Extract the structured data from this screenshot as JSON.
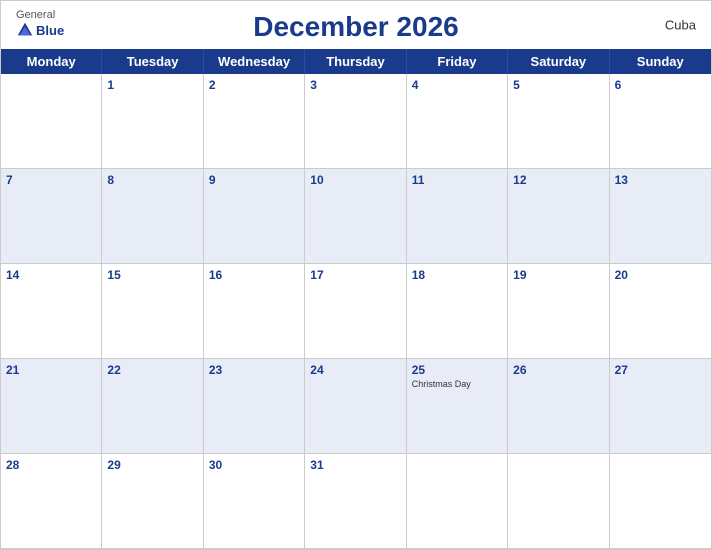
{
  "header": {
    "logo_general": "General",
    "logo_blue": "Blue",
    "title": "December 2026",
    "country": "Cuba"
  },
  "day_headers": [
    "Monday",
    "Tuesday",
    "Wednesday",
    "Thursday",
    "Friday",
    "Saturday",
    "Sunday"
  ],
  "weeks": [
    [
      {
        "date": "",
        "event": ""
      },
      {
        "date": "1",
        "event": ""
      },
      {
        "date": "2",
        "event": ""
      },
      {
        "date": "3",
        "event": ""
      },
      {
        "date": "4",
        "event": ""
      },
      {
        "date": "5",
        "event": ""
      },
      {
        "date": "6",
        "event": ""
      }
    ],
    [
      {
        "date": "7",
        "event": ""
      },
      {
        "date": "8",
        "event": ""
      },
      {
        "date": "9",
        "event": ""
      },
      {
        "date": "10",
        "event": ""
      },
      {
        "date": "11",
        "event": ""
      },
      {
        "date": "12",
        "event": ""
      },
      {
        "date": "13",
        "event": ""
      }
    ],
    [
      {
        "date": "14",
        "event": ""
      },
      {
        "date": "15",
        "event": ""
      },
      {
        "date": "16",
        "event": ""
      },
      {
        "date": "17",
        "event": ""
      },
      {
        "date": "18",
        "event": ""
      },
      {
        "date": "19",
        "event": ""
      },
      {
        "date": "20",
        "event": ""
      }
    ],
    [
      {
        "date": "21",
        "event": ""
      },
      {
        "date": "22",
        "event": ""
      },
      {
        "date": "23",
        "event": ""
      },
      {
        "date": "24",
        "event": ""
      },
      {
        "date": "25",
        "event": "Christmas Day"
      },
      {
        "date": "26",
        "event": ""
      },
      {
        "date": "27",
        "event": ""
      }
    ],
    [
      {
        "date": "28",
        "event": ""
      },
      {
        "date": "29",
        "event": ""
      },
      {
        "date": "30",
        "event": ""
      },
      {
        "date": "31",
        "event": ""
      },
      {
        "date": "",
        "event": ""
      },
      {
        "date": "",
        "event": ""
      },
      {
        "date": "",
        "event": ""
      }
    ]
  ]
}
